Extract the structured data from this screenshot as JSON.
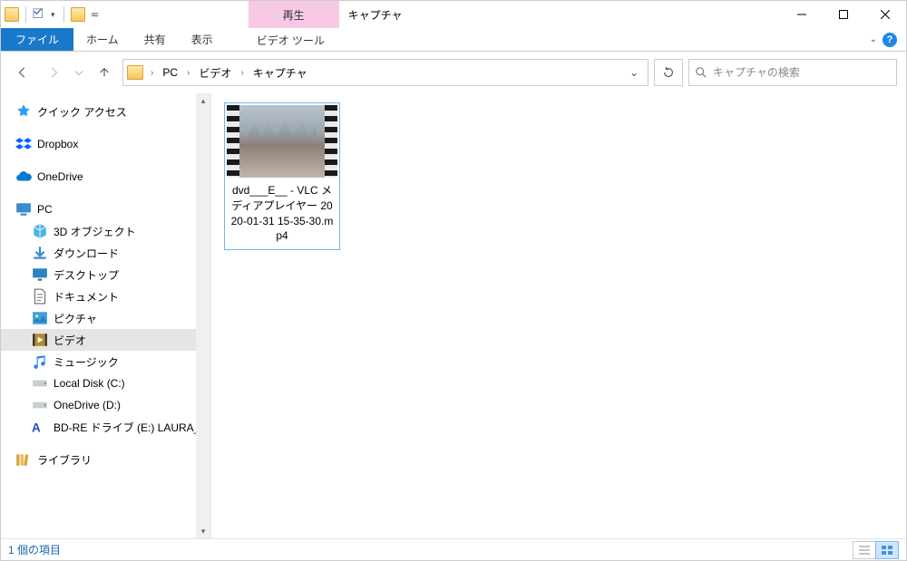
{
  "window": {
    "context_tab": "再生",
    "title": "キャプチャ"
  },
  "ribbon": {
    "file": "ファイル",
    "home": "ホーム",
    "share": "共有",
    "view": "表示",
    "video_tools": "ビデオ ツール"
  },
  "breadcrumb": {
    "pc": "PC",
    "video": "ビデオ",
    "capture": "キャプチャ"
  },
  "search": {
    "placeholder": "キャプチャの検索"
  },
  "tree": {
    "quick_access": "クイック アクセス",
    "dropbox": "Dropbox",
    "onedrive": "OneDrive",
    "pc": "PC",
    "objects3d": "3D オブジェクト",
    "downloads": "ダウンロード",
    "desktop": "デスクトップ",
    "documents": "ドキュメント",
    "pictures": "ピクチャ",
    "videos": "ビデオ",
    "music": "ミュージック",
    "local_c": "Local Disk (C:)",
    "onedrive_d": "OneDrive (D:)",
    "bdre": "BD-RE ドライブ (E:) LAURA_RE",
    "libraries": "ライブラリ"
  },
  "file": {
    "name": "dvd___E__ - VLC メディアプレイヤー 2020-01-31 15-35-30.mp4"
  },
  "status": {
    "count": "1 個の項目"
  }
}
